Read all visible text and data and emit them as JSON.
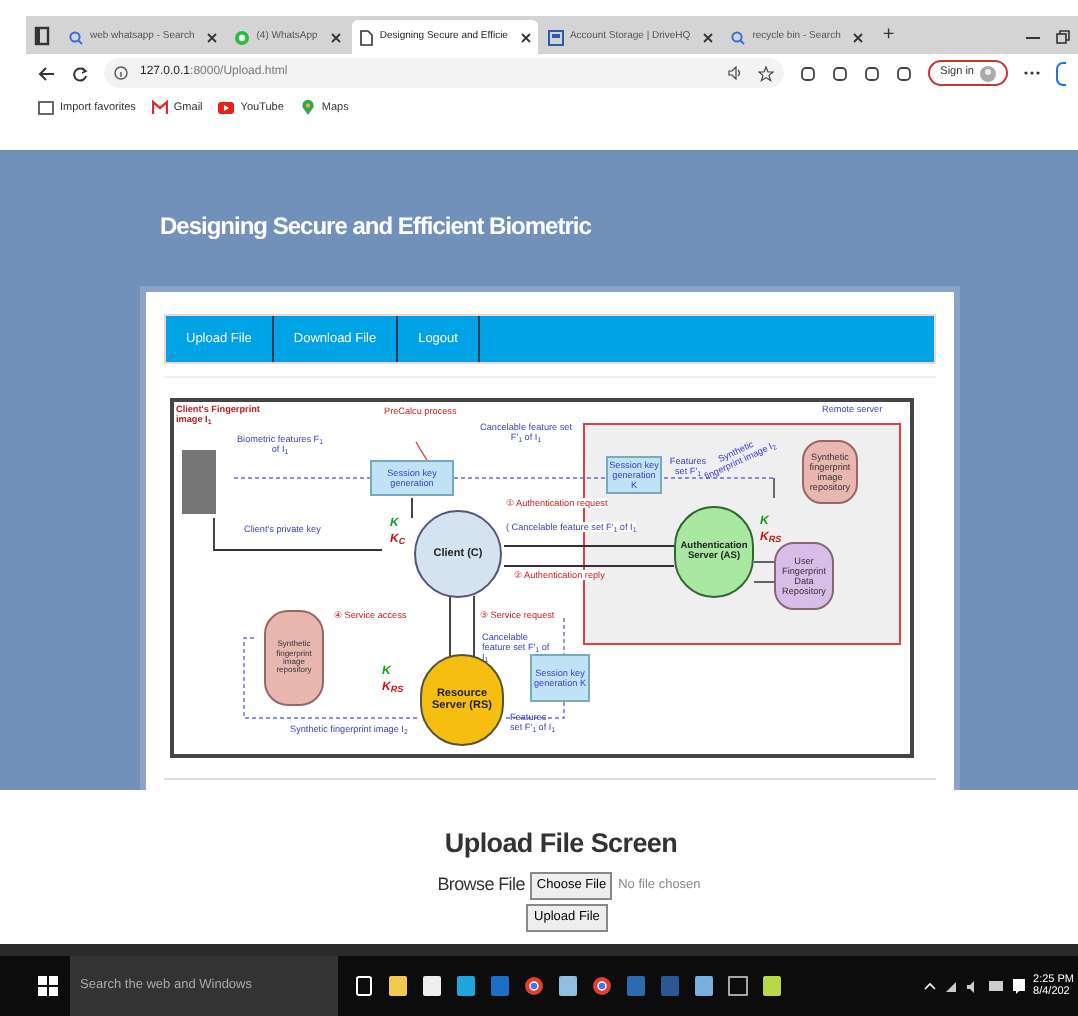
{
  "browser": {
    "tabs": [
      {
        "title": "web whatsapp - Search",
        "kind": "search",
        "selected": false
      },
      {
        "title": "(4) WhatsApp",
        "kind": "chat",
        "selected": false
      },
      {
        "title": "Designing Secure and Efficie",
        "kind": "page",
        "selected": true
      },
      {
        "title": "Account Storage | DriveHQ",
        "kind": "storage",
        "selected": false
      },
      {
        "title": "recycle bin - Search",
        "kind": "search",
        "selected": false
      }
    ],
    "new_tab": "+",
    "address": {
      "host": "127.0.0.1",
      "rest": ":8000/Upload.html"
    },
    "sign_in": "Sign in",
    "bookmarks": [
      {
        "label": "Import favorites",
        "kind": "folder"
      },
      {
        "label": "Gmail",
        "kind": "mail"
      },
      {
        "label": "YouTube",
        "kind": "video"
      },
      {
        "label": "Maps",
        "kind": "map"
      }
    ]
  },
  "page": {
    "title": "Designing Secure and Efficient Biometric",
    "nav": [
      "Upload File",
      "Download File",
      "Logout"
    ],
    "diagram": {
      "fingerprint_caption": "Client's Fingerprint image I$_{1}$",
      "biometric": "Biometric features F$_{1}$ of I$_{1}$",
      "precalc": "PreCalcu process",
      "cancelable_top": "Cancelable feature set F'$_{1}$ of I$_{1}$",
      "session_key_client": "Session key generation",
      "private_key": "Client's private key",
      "client_keys": [
        "K",
        "K$_{C}$"
      ],
      "client": "Client (C)",
      "auth_request": "① Authentication request",
      "auth_request_note": "( Cancelable feature set F'$_{1}$ of I$_{1}$",
      "auth_reply": "② Authentication reply",
      "remote_server": "Remote server",
      "session_key_as": "Session key generation K",
      "features_as": "Features set F'$_{1}$",
      "synthetic_as": "Synthetic fingerprint image I$_{2}$",
      "repo_as": "Synthetic fingerprint image repository",
      "user_repo": "User Fingerprint Data Repository",
      "as": "Authentication Server (AS)",
      "as_keys": [
        "K",
        "K$_{RS}$"
      ],
      "service_access": "④ Service access",
      "service_request": "③ Service request",
      "cancelable_rs": "Cancelable feature set F'$_{1}$ of I$_{1}$",
      "session_key_rs": "Session key generation K",
      "features_rs": "Features set F'$_{1}$ of I$_{1}$",
      "repo_rs": "Synthetic fingerprint image repository",
      "synthetic_rs": "Synthetic fingerprint image I$_{2}$",
      "rs_keys": [
        "K",
        "K$_{RS}$"
      ],
      "rs": "Resource Server (RS)"
    },
    "upload": {
      "heading": "Upload File Screen",
      "label": "Browse File",
      "choose": "Choose File",
      "no_file": "No file chosen",
      "submit": "Upload File"
    }
  },
  "taskbar": {
    "search": "Search the web and Windows",
    "time": "2:25 PM",
    "date": "8/4/202"
  }
}
